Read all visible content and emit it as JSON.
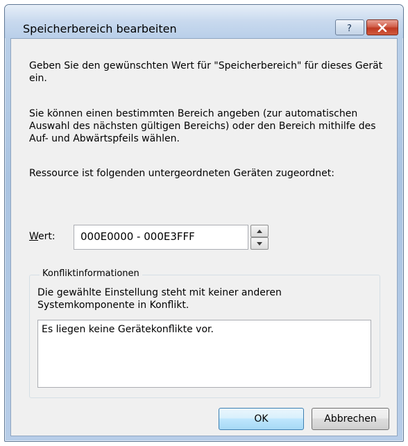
{
  "window": {
    "title": "Speicherbereich bearbeiten",
    "help_icon": "help-icon",
    "close_icon": "close-icon"
  },
  "content": {
    "intro": "Geben Sie den gewünschten Wert für \"Speicherbereich\" für dieses Gerät ein.",
    "instructions": "Sie können einen bestimmten Bereich angeben (zur automatischen Auswahl des nächsten gültigen Bereichs) oder den Bereich mithilfe des Auf- und Abwärtspfeils wählen.",
    "resource_note": "Ressource ist folgenden untergeordneten Geräten zugeordnet:"
  },
  "value_field": {
    "label_underlined": "W",
    "label_rest": "ert:",
    "value": "000E0000 - 000E3FFF"
  },
  "conflict_group": {
    "legend": "Konfliktinformationen",
    "description": "Die gewählte Einstellung steht mit keiner anderen Systemkomponente in Konflikt.",
    "list_text": "Es liegen keine Gerätekonflikte vor."
  },
  "buttons": {
    "ok": "OK",
    "cancel": "Abbrechen"
  },
  "colors": {
    "title_frame": "#aac4e2",
    "client_bg": "#f0f0f0",
    "close_button": "#d2604c"
  }
}
